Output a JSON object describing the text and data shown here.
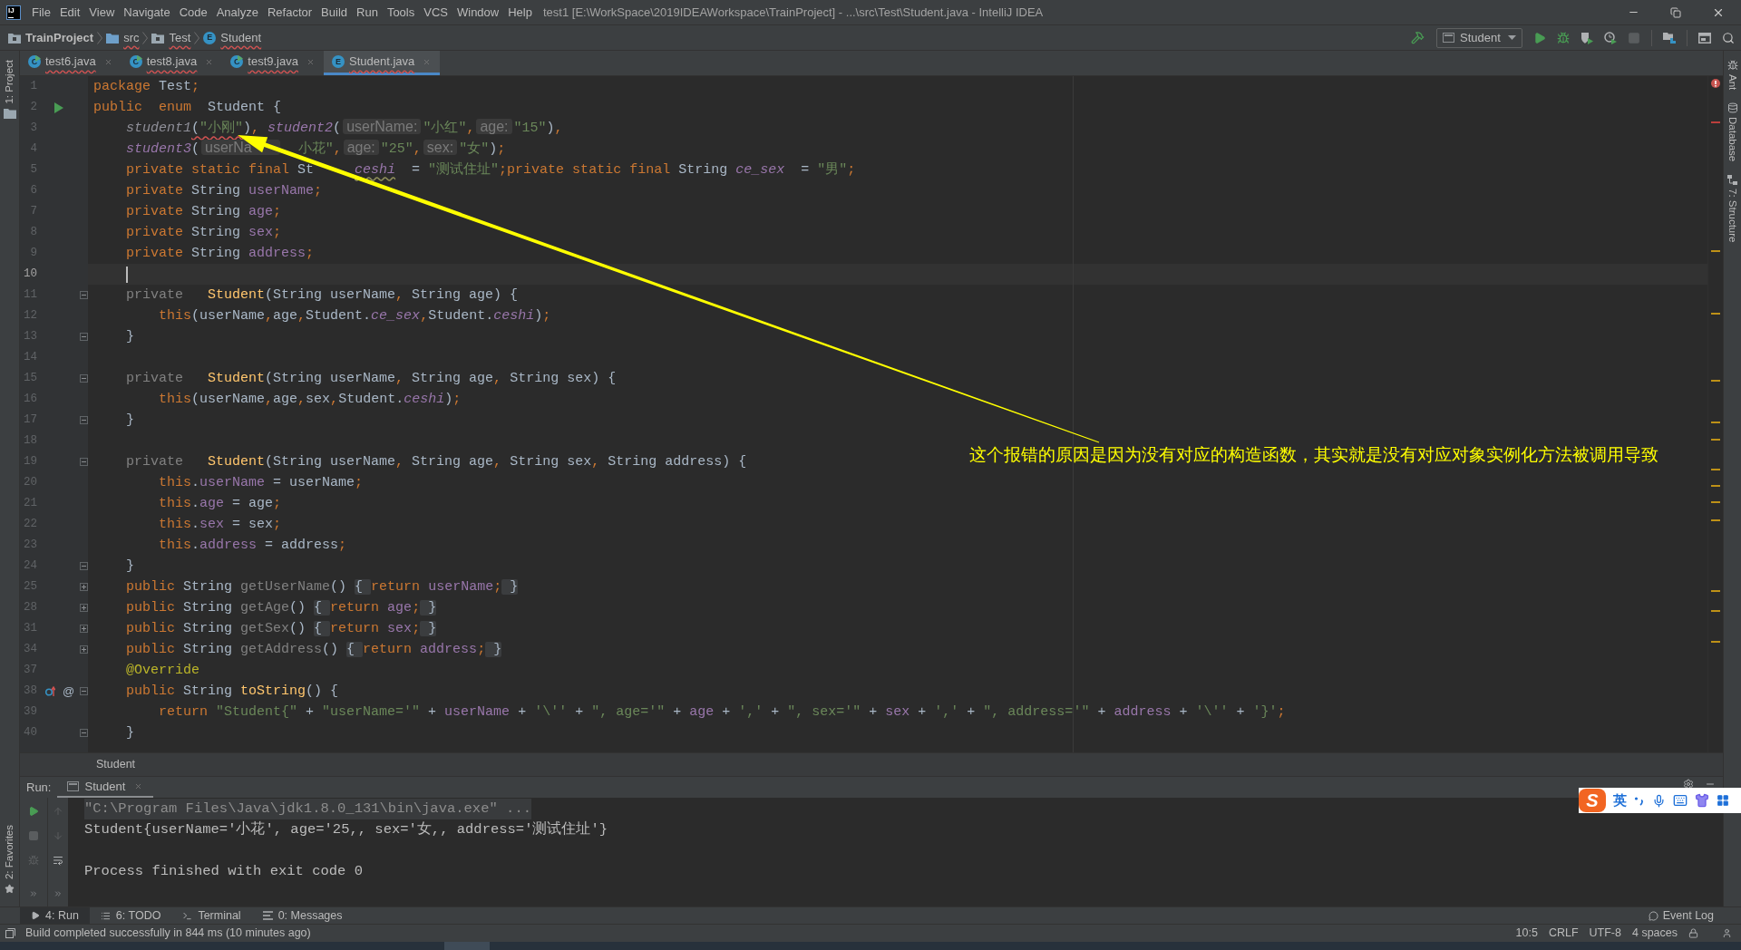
{
  "window": {
    "logo": "IJ",
    "menu": [
      "File",
      "Edit",
      "View",
      "Navigate",
      "Code",
      "Analyze",
      "Refactor",
      "Build",
      "Run",
      "Tools",
      "VCS",
      "Window",
      "Help"
    ],
    "title": "test1 [E:\\WorkSpace\\2019IDEAWorkspace\\TrainProject] - ...\\src\\Test\\Student.java - IntelliJ IDEA"
  },
  "navigation_bar": {
    "crumbs": [
      {
        "label": "TrainProject",
        "kind": "project",
        "error": false
      },
      {
        "label": "src",
        "kind": "folder",
        "error": true
      },
      {
        "label": "Test",
        "kind": "package",
        "error": true
      },
      {
        "label": "Student",
        "kind": "enum",
        "icon_letter": "E",
        "error": true
      }
    ],
    "run_config": "Student"
  },
  "tool_strips": {
    "left": [
      {
        "label": "1: Project",
        "kind": "project"
      }
    ],
    "left_bottom": [
      {
        "label": "2: Favorites",
        "kind": "favorites"
      }
    ],
    "right": [
      {
        "label": "Ant",
        "kind": "ant"
      },
      {
        "label": "Database",
        "kind": "database"
      },
      {
        "label": "7: Structure",
        "kind": "structure"
      }
    ]
  },
  "editor_tabs": [
    {
      "label": "test6.java",
      "kind": "class",
      "icon_letter": "C",
      "selected": false,
      "error": true
    },
    {
      "label": "test8.java",
      "kind": "class",
      "icon_letter": "C",
      "selected": false,
      "error": true
    },
    {
      "label": "test9.java",
      "kind": "class",
      "icon_letter": "C",
      "selected": false,
      "error": true
    },
    {
      "label": "Student.java",
      "kind": "enum",
      "icon_letter": "E",
      "selected": true,
      "error": true
    }
  ],
  "editor": {
    "lines": [
      {
        "number": "1",
        "current": false,
        "tokens": [
          {
            "text": "package",
            "kind": "kw"
          },
          {
            "text": " Test",
            "kind": "plain"
          },
          {
            "text": ";",
            "kind": "kw"
          }
        ]
      },
      {
        "number": "2",
        "current": false,
        "gutter": [
          {
            "kind": "run"
          }
        ],
        "tokens": [
          {
            "text": "public  enum  ",
            "kind": "kw"
          },
          {
            "text": "Student {",
            "kind": "plain"
          }
        ]
      },
      {
        "number": "3",
        "current": false,
        "tokens": [
          {
            "text": "    student1",
            "kind": "dim_const"
          },
          {
            "text": "(",
            "kind": "plain_err"
          },
          {
            "text": "\"小刚\"",
            "kind": "str_err"
          },
          {
            "text": ")",
            "kind": "plain"
          },
          {
            "text": ", ",
            "kind": "kw"
          },
          {
            "text": "student2",
            "kind": "const"
          },
          {
            "text": "(",
            "kind": "plain"
          },
          {
            "text": "userName:",
            "kind": "hint"
          },
          {
            "text": "\"小红\"",
            "kind": "str"
          },
          {
            "text": ",",
            "kind": "kw"
          },
          {
            "text": "age:",
            "kind": "hint"
          },
          {
            "text": "\"15\"",
            "kind": "str"
          },
          {
            "text": ")",
            "kind": "plain"
          },
          {
            "text": ",",
            "kind": "kw"
          }
        ]
      },
      {
        "number": "4",
        "current": false,
        "tokens": [
          {
            "text": "    student3",
            "kind": "const"
          },
          {
            "text": "(",
            "kind": "plain"
          },
          {
            "text": "userNa",
            "kind": "hint_cut"
          },
          {
            "text": "小花\"",
            "kind": "str_gap"
          },
          {
            "text": ",",
            "kind": "kw"
          },
          {
            "text": "age:",
            "kind": "hint"
          },
          {
            "text": "\"25\"",
            "kind": "str"
          },
          {
            "text": ",",
            "kind": "kw"
          },
          {
            "text": "sex:",
            "kind": "hint"
          },
          {
            "text": "\"女\"",
            "kind": "str"
          },
          {
            "text": ")",
            "kind": "plain"
          },
          {
            "text": ";",
            "kind": "kw"
          }
        ]
      },
      {
        "number": "5",
        "current": false,
        "tokens": [
          {
            "text": "    private static final ",
            "kind": "kw"
          },
          {
            "text": "St",
            "kind": "plain"
          },
          {
            "text": "ceshi",
            "kind": "const_warn_gap"
          },
          {
            "text": "  = ",
            "kind": "plain"
          },
          {
            "text": "\"测试住址\"",
            "kind": "str"
          },
          {
            "text": ";private static final ",
            "kind": "kw"
          },
          {
            "text": "String ",
            "kind": "plain"
          },
          {
            "text": "ce_sex",
            "kind": "const"
          },
          {
            "text": "  = ",
            "kind": "plain"
          },
          {
            "text": "\"男\"",
            "kind": "str"
          },
          {
            "text": ";",
            "kind": "kw"
          }
        ]
      },
      {
        "number": "6",
        "current": false,
        "tokens": [
          {
            "text": "    private ",
            "kind": "kw"
          },
          {
            "text": "String ",
            "kind": "plain"
          },
          {
            "text": "userName",
            "kind": "field"
          },
          {
            "text": ";",
            "kind": "kw"
          }
        ]
      },
      {
        "number": "7",
        "current": false,
        "tokens": [
          {
            "text": "    private ",
            "kind": "kw"
          },
          {
            "text": "String ",
            "kind": "plain"
          },
          {
            "text": "age",
            "kind": "field"
          },
          {
            "text": ";",
            "kind": "kw"
          }
        ]
      },
      {
        "number": "8",
        "current": false,
        "tokens": [
          {
            "text": "    private ",
            "kind": "kw"
          },
          {
            "text": "String ",
            "kind": "plain"
          },
          {
            "text": "sex",
            "kind": "field"
          },
          {
            "text": ";",
            "kind": "kw"
          }
        ]
      },
      {
        "number": "9",
        "current": false,
        "tokens": [
          {
            "text": "    private ",
            "kind": "kw"
          },
          {
            "text": "String ",
            "kind": "plain"
          },
          {
            "text": "address",
            "kind": "field"
          },
          {
            "text": ";",
            "kind": "kw"
          }
        ]
      },
      {
        "number": "10",
        "current": true
      },
      {
        "number": "11",
        "current": false,
        "gutter": [
          {
            "kind": "fold_start"
          }
        ],
        "tokens": [
          {
            "text": "    private   ",
            "kind": "muted"
          },
          {
            "text": "Student",
            "kind": "method"
          },
          {
            "text": "(String userName",
            "kind": "plain"
          },
          {
            "text": ", ",
            "kind": "kw"
          },
          {
            "text": "String age) {",
            "kind": "plain"
          }
        ]
      },
      {
        "number": "12",
        "current": false,
        "tokens": [
          {
            "text": "        this",
            "kind": "kw"
          },
          {
            "text": "(userName",
            "kind": "plain"
          },
          {
            "text": ",",
            "kind": "kw"
          },
          {
            "text": "age",
            "kind": "plain"
          },
          {
            "text": ",",
            "kind": "kw"
          },
          {
            "text": "Student.",
            "kind": "plain"
          },
          {
            "text": "ce_sex",
            "kind": "const"
          },
          {
            "text": ",",
            "kind": "kw"
          },
          {
            "text": "Student.",
            "kind": "plain"
          },
          {
            "text": "ceshi",
            "kind": "const"
          },
          {
            "text": ")",
            "kind": "plain"
          },
          {
            "text": ";",
            "kind": "kw"
          }
        ]
      },
      {
        "number": "13",
        "current": false,
        "gutter": [
          {
            "kind": "fold_end"
          }
        ],
        "tokens": [
          {
            "text": "    }",
            "kind": "plain"
          }
        ]
      },
      {
        "number": "14",
        "current": false
      },
      {
        "number": "15",
        "current": false,
        "gutter": [
          {
            "kind": "fold_start"
          }
        ],
        "tokens": [
          {
            "text": "    private   ",
            "kind": "muted"
          },
          {
            "text": "Student",
            "kind": "method"
          },
          {
            "text": "(String userName",
            "kind": "plain"
          },
          {
            "text": ", ",
            "kind": "kw"
          },
          {
            "text": "String age",
            "kind": "plain"
          },
          {
            "text": ", ",
            "kind": "kw"
          },
          {
            "text": "String sex) {",
            "kind": "plain"
          }
        ]
      },
      {
        "number": "16",
        "current": false,
        "tokens": [
          {
            "text": "        this",
            "kind": "kw"
          },
          {
            "text": "(userName",
            "kind": "plain"
          },
          {
            "text": ",",
            "kind": "kw"
          },
          {
            "text": "age",
            "kind": "plain"
          },
          {
            "text": ",",
            "kind": "kw"
          },
          {
            "text": "sex",
            "kind": "plain"
          },
          {
            "text": ",",
            "kind": "kw"
          },
          {
            "text": "Student.",
            "kind": "plain"
          },
          {
            "text": "ceshi",
            "kind": "const"
          },
          {
            "text": ")",
            "kind": "plain"
          },
          {
            "text": ";",
            "kind": "kw"
          }
        ]
      },
      {
        "number": "17",
        "current": false,
        "gutter": [
          {
            "kind": "fold_end"
          }
        ],
        "tokens": [
          {
            "text": "    }",
            "kind": "plain"
          }
        ]
      },
      {
        "number": "18",
        "current": false
      },
      {
        "number": "19",
        "current": false,
        "gutter": [
          {
            "kind": "fold_start"
          }
        ],
        "tokens": [
          {
            "text": "    private   ",
            "kind": "muted"
          },
          {
            "text": "Student",
            "kind": "method"
          },
          {
            "text": "(String userName",
            "kind": "plain"
          },
          {
            "text": ", ",
            "kind": "kw"
          },
          {
            "text": "String age",
            "kind": "plain"
          },
          {
            "text": ", ",
            "kind": "kw"
          },
          {
            "text": "String sex",
            "kind": "plain"
          },
          {
            "text": ", ",
            "kind": "kw"
          },
          {
            "text": "String address) {",
            "kind": "plain"
          }
        ]
      },
      {
        "number": "20",
        "current": false,
        "tokens": [
          {
            "text": "        this",
            "kind": "kw"
          },
          {
            "text": ".",
            "kind": "plain"
          },
          {
            "text": "userName",
            "kind": "field"
          },
          {
            "text": " = userName",
            "kind": "plain"
          },
          {
            "text": ";",
            "kind": "kw"
          }
        ]
      },
      {
        "number": "21",
        "current": false,
        "tokens": [
          {
            "text": "        this",
            "kind": "kw"
          },
          {
            "text": ".",
            "kind": "plain"
          },
          {
            "text": "age",
            "kind": "field"
          },
          {
            "text": " = age",
            "kind": "plain"
          },
          {
            "text": ";",
            "kind": "kw"
          }
        ]
      },
      {
        "number": "22",
        "current": false,
        "tokens": [
          {
            "text": "        this",
            "kind": "kw"
          },
          {
            "text": ".",
            "kind": "plain"
          },
          {
            "text": "sex",
            "kind": "field"
          },
          {
            "text": " = sex",
            "kind": "plain"
          },
          {
            "text": ";",
            "kind": "kw"
          }
        ]
      },
      {
        "number": "23",
        "current": false,
        "tokens": [
          {
            "text": "        this",
            "kind": "kw"
          },
          {
            "text": ".",
            "kind": "plain"
          },
          {
            "text": "address",
            "kind": "field"
          },
          {
            "text": " = address",
            "kind": "plain"
          },
          {
            "text": ";",
            "kind": "kw"
          }
        ]
      },
      {
        "number": "24",
        "current": false,
        "gutter": [
          {
            "kind": "fold_end"
          }
        ],
        "tokens": [
          {
            "text": "    }",
            "kind": "plain"
          }
        ]
      },
      {
        "number": "25",
        "current": false,
        "gutter": [
          {
            "kind": "fold_collapsed"
          }
        ],
        "tokens": [
          {
            "text": "    public ",
            "kind": "kw"
          },
          {
            "text": "String ",
            "kind": "plain"
          },
          {
            "text": "getUserName",
            "kind": "muted"
          },
          {
            "text": "() ",
            "kind": "plain"
          },
          {
            "text": "{ ",
            "kind": "fold"
          },
          {
            "text": "return ",
            "kind": "kw"
          },
          {
            "text": "userName",
            "kind": "field"
          },
          {
            "text": ";",
            "kind": "kw"
          },
          {
            "text": " }",
            "kind": "fold"
          }
        ]
      },
      {
        "number": "28",
        "current": false,
        "gutter": [
          {
            "kind": "fold_collapsed"
          }
        ],
        "tokens": [
          {
            "text": "    public ",
            "kind": "kw"
          },
          {
            "text": "String ",
            "kind": "plain"
          },
          {
            "text": "getAge",
            "kind": "muted"
          },
          {
            "text": "() ",
            "kind": "plain"
          },
          {
            "text": "{ ",
            "kind": "fold"
          },
          {
            "text": "return ",
            "kind": "kw"
          },
          {
            "text": "age",
            "kind": "field"
          },
          {
            "text": ";",
            "kind": "kw"
          },
          {
            "text": " }",
            "kind": "fold"
          }
        ]
      },
      {
        "number": "31",
        "current": false,
        "gutter": [
          {
            "kind": "fold_collapsed"
          }
        ],
        "tokens": [
          {
            "text": "    public ",
            "kind": "kw"
          },
          {
            "text": "String ",
            "kind": "plain"
          },
          {
            "text": "getSex",
            "kind": "muted"
          },
          {
            "text": "() ",
            "kind": "plain"
          },
          {
            "text": "{ ",
            "kind": "fold"
          },
          {
            "text": "return ",
            "kind": "kw"
          },
          {
            "text": "sex",
            "kind": "field"
          },
          {
            "text": ";",
            "kind": "kw"
          },
          {
            "text": " }",
            "kind": "fold"
          }
        ]
      },
      {
        "number": "34",
        "current": false,
        "gutter": [
          {
            "kind": "fold_collapsed"
          }
        ],
        "tokens": [
          {
            "text": "    public ",
            "kind": "kw"
          },
          {
            "text": "String ",
            "kind": "plain"
          },
          {
            "text": "getAddress",
            "kind": "muted"
          },
          {
            "text": "() ",
            "kind": "plain"
          },
          {
            "text": "{ ",
            "kind": "fold"
          },
          {
            "text": "return ",
            "kind": "kw"
          },
          {
            "text": "address",
            "kind": "field"
          },
          {
            "text": ";",
            "kind": "kw"
          },
          {
            "text": " }",
            "kind": "fold"
          }
        ]
      },
      {
        "number": "37",
        "current": false,
        "tokens": [
          {
            "text": "    @Override",
            "kind": "annot"
          }
        ]
      },
      {
        "number": "38",
        "current": false,
        "gutter": [
          {
            "kind": "override"
          },
          {
            "kind": "at",
            "text": "@"
          },
          {
            "kind": "fold_start"
          }
        ],
        "tokens": [
          {
            "text": "    public ",
            "kind": "kw"
          },
          {
            "text": "String ",
            "kind": "plain"
          },
          {
            "text": "toString",
            "kind": "method"
          },
          {
            "text": "() {",
            "kind": "plain"
          }
        ]
      },
      {
        "number": "39",
        "current": false,
        "tokens": [
          {
            "text": "        return ",
            "kind": "kw"
          },
          {
            "text": "\"Student{\"",
            "kind": "str"
          },
          {
            "text": " + ",
            "kind": "plain"
          },
          {
            "text": "\"userName='\"",
            "kind": "str"
          },
          {
            "text": " + ",
            "kind": "plain"
          },
          {
            "text": "userName",
            "kind": "field"
          },
          {
            "text": " + ",
            "kind": "plain"
          },
          {
            "text": "'\\''",
            "kind": "str"
          },
          {
            "text": " + ",
            "kind": "plain"
          },
          {
            "text": "\", age='\"",
            "kind": "str"
          },
          {
            "text": " + ",
            "kind": "plain"
          },
          {
            "text": "age",
            "kind": "field"
          },
          {
            "text": " + ",
            "kind": "plain"
          },
          {
            "text": "','",
            "kind": "str"
          },
          {
            "text": " + ",
            "kind": "plain"
          },
          {
            "text": "\", sex='\"",
            "kind": "str"
          },
          {
            "text": " + ",
            "kind": "plain"
          },
          {
            "text": "sex",
            "kind": "field"
          },
          {
            "text": " + ",
            "kind": "plain"
          },
          {
            "text": "','",
            "kind": "str"
          },
          {
            "text": " + ",
            "kind": "plain"
          },
          {
            "text": "\", address='\"",
            "kind": "str"
          },
          {
            "text": " + ",
            "kind": "plain"
          },
          {
            "text": "address",
            "kind": "field"
          },
          {
            "text": " + ",
            "kind": "plain"
          },
          {
            "text": "'\\''",
            "kind": "str"
          },
          {
            "text": " + ",
            "kind": "plain"
          },
          {
            "text": "'}'",
            "kind": "str"
          },
          {
            "text": ";",
            "kind": "kw"
          }
        ]
      },
      {
        "number": "40",
        "current": false,
        "gutter": [
          {
            "kind": "fold_end"
          }
        ],
        "tokens": [
          {
            "text": "    }",
            "kind": "plain"
          }
        ]
      }
    ],
    "annotation": "这个报错的原因是因为没有对应的构造函数，其实就是没有对应对象实例化方法被调用导致",
    "breadcrumb": "Student"
  },
  "run_panel": {
    "label": "Run:",
    "tabs": [
      {
        "label": "Student",
        "selected": true
      }
    ],
    "console": [
      {
        "text": "\"C:\\Program Files\\Java\\jdk1.8.0_131\\bin\\java.exe\" ...",
        "kind": "command"
      },
      {
        "text": "Student{userName='小花', age='25,, sex='女,, address='测试住址'}",
        "kind": "output"
      },
      {
        "text": "Process finished with exit code 0",
        "kind": "exit"
      }
    ]
  },
  "tool_window_bar": {
    "buttons": [
      {
        "label": "4: Run",
        "kind": "run",
        "selected": true
      },
      {
        "label": "6: TODO",
        "kind": "todo",
        "selected": false
      },
      {
        "label": "Terminal",
        "kind": "terminal",
        "selected": false
      },
      {
        "label": "0: Messages",
        "kind": "messages",
        "selected": false
      }
    ],
    "event_log": "Event Log"
  },
  "status_bar": {
    "message": "Build completed successfully in 844 ms (10 minutes ago)",
    "items": [
      "10:5",
      "CRLF",
      "UTF-8",
      "4 spaces"
    ]
  },
  "input_method": {
    "logo": "S",
    "mode": "英"
  }
}
